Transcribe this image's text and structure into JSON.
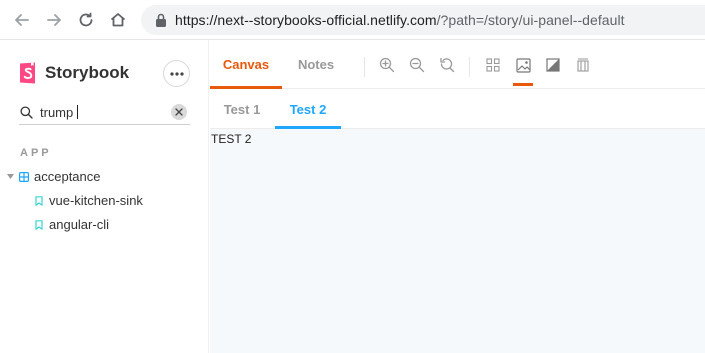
{
  "browser": {
    "url_host": "https://next--storybooks-official.netlify.com",
    "url_path": "/?path=/story/ui-panel--default"
  },
  "sidebar": {
    "brand": "Storybook",
    "search": {
      "value": "trump"
    },
    "section_title": "APP",
    "tree": [
      {
        "label": "acceptance",
        "kind": "folder",
        "expanded": true
      },
      {
        "label": "vue-kitchen-sink",
        "kind": "story"
      },
      {
        "label": "angular-cli",
        "kind": "story"
      }
    ]
  },
  "toolbar": {
    "tabs": [
      {
        "label": "Canvas",
        "active": true
      },
      {
        "label": "Notes",
        "active": false
      }
    ],
    "tools": [
      "zoom-in-icon",
      "zoom-out-icon",
      "reset-zoom-icon",
      "grid-icon",
      "background-icon",
      "outline-icon",
      "measure-icon"
    ]
  },
  "panel": {
    "tabs": [
      {
        "label": "Test 1",
        "active": false
      },
      {
        "label": "Test 2",
        "active": true
      }
    ],
    "content": "TEST 2"
  },
  "colors": {
    "accent": "#e8590c",
    "secondary": "#1ea7fd",
    "brand": "#ff4785"
  }
}
